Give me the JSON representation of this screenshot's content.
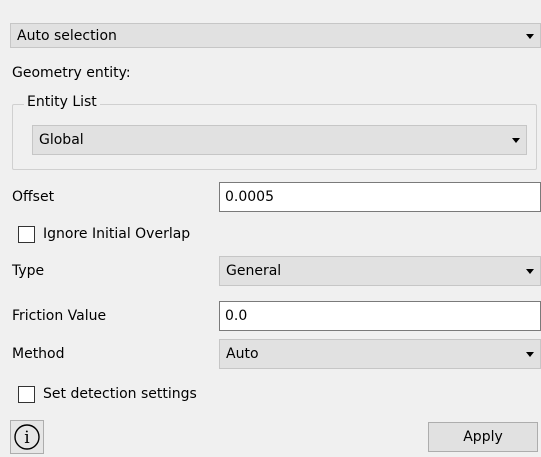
{
  "selection_mode": {
    "value": "Auto selection"
  },
  "geometry_entity_label": "Geometry entity:",
  "entity_list": {
    "title": "Entity List",
    "value": "Global"
  },
  "offset": {
    "label": "Offset",
    "value": "0.0005"
  },
  "ignore_initial_overlap": {
    "label": "Ignore Initial Overlap",
    "checked": false
  },
  "type": {
    "label": "Type",
    "value": "General"
  },
  "friction_value": {
    "label": "Friction Value",
    "value": "0.0"
  },
  "method": {
    "label": "Method",
    "value": "Auto"
  },
  "set_detection_settings": {
    "label": "Set detection settings",
    "checked": false
  },
  "info_icon": {
    "glyph": "i",
    "icon": "info-icon"
  },
  "apply_button": {
    "label": "Apply"
  }
}
